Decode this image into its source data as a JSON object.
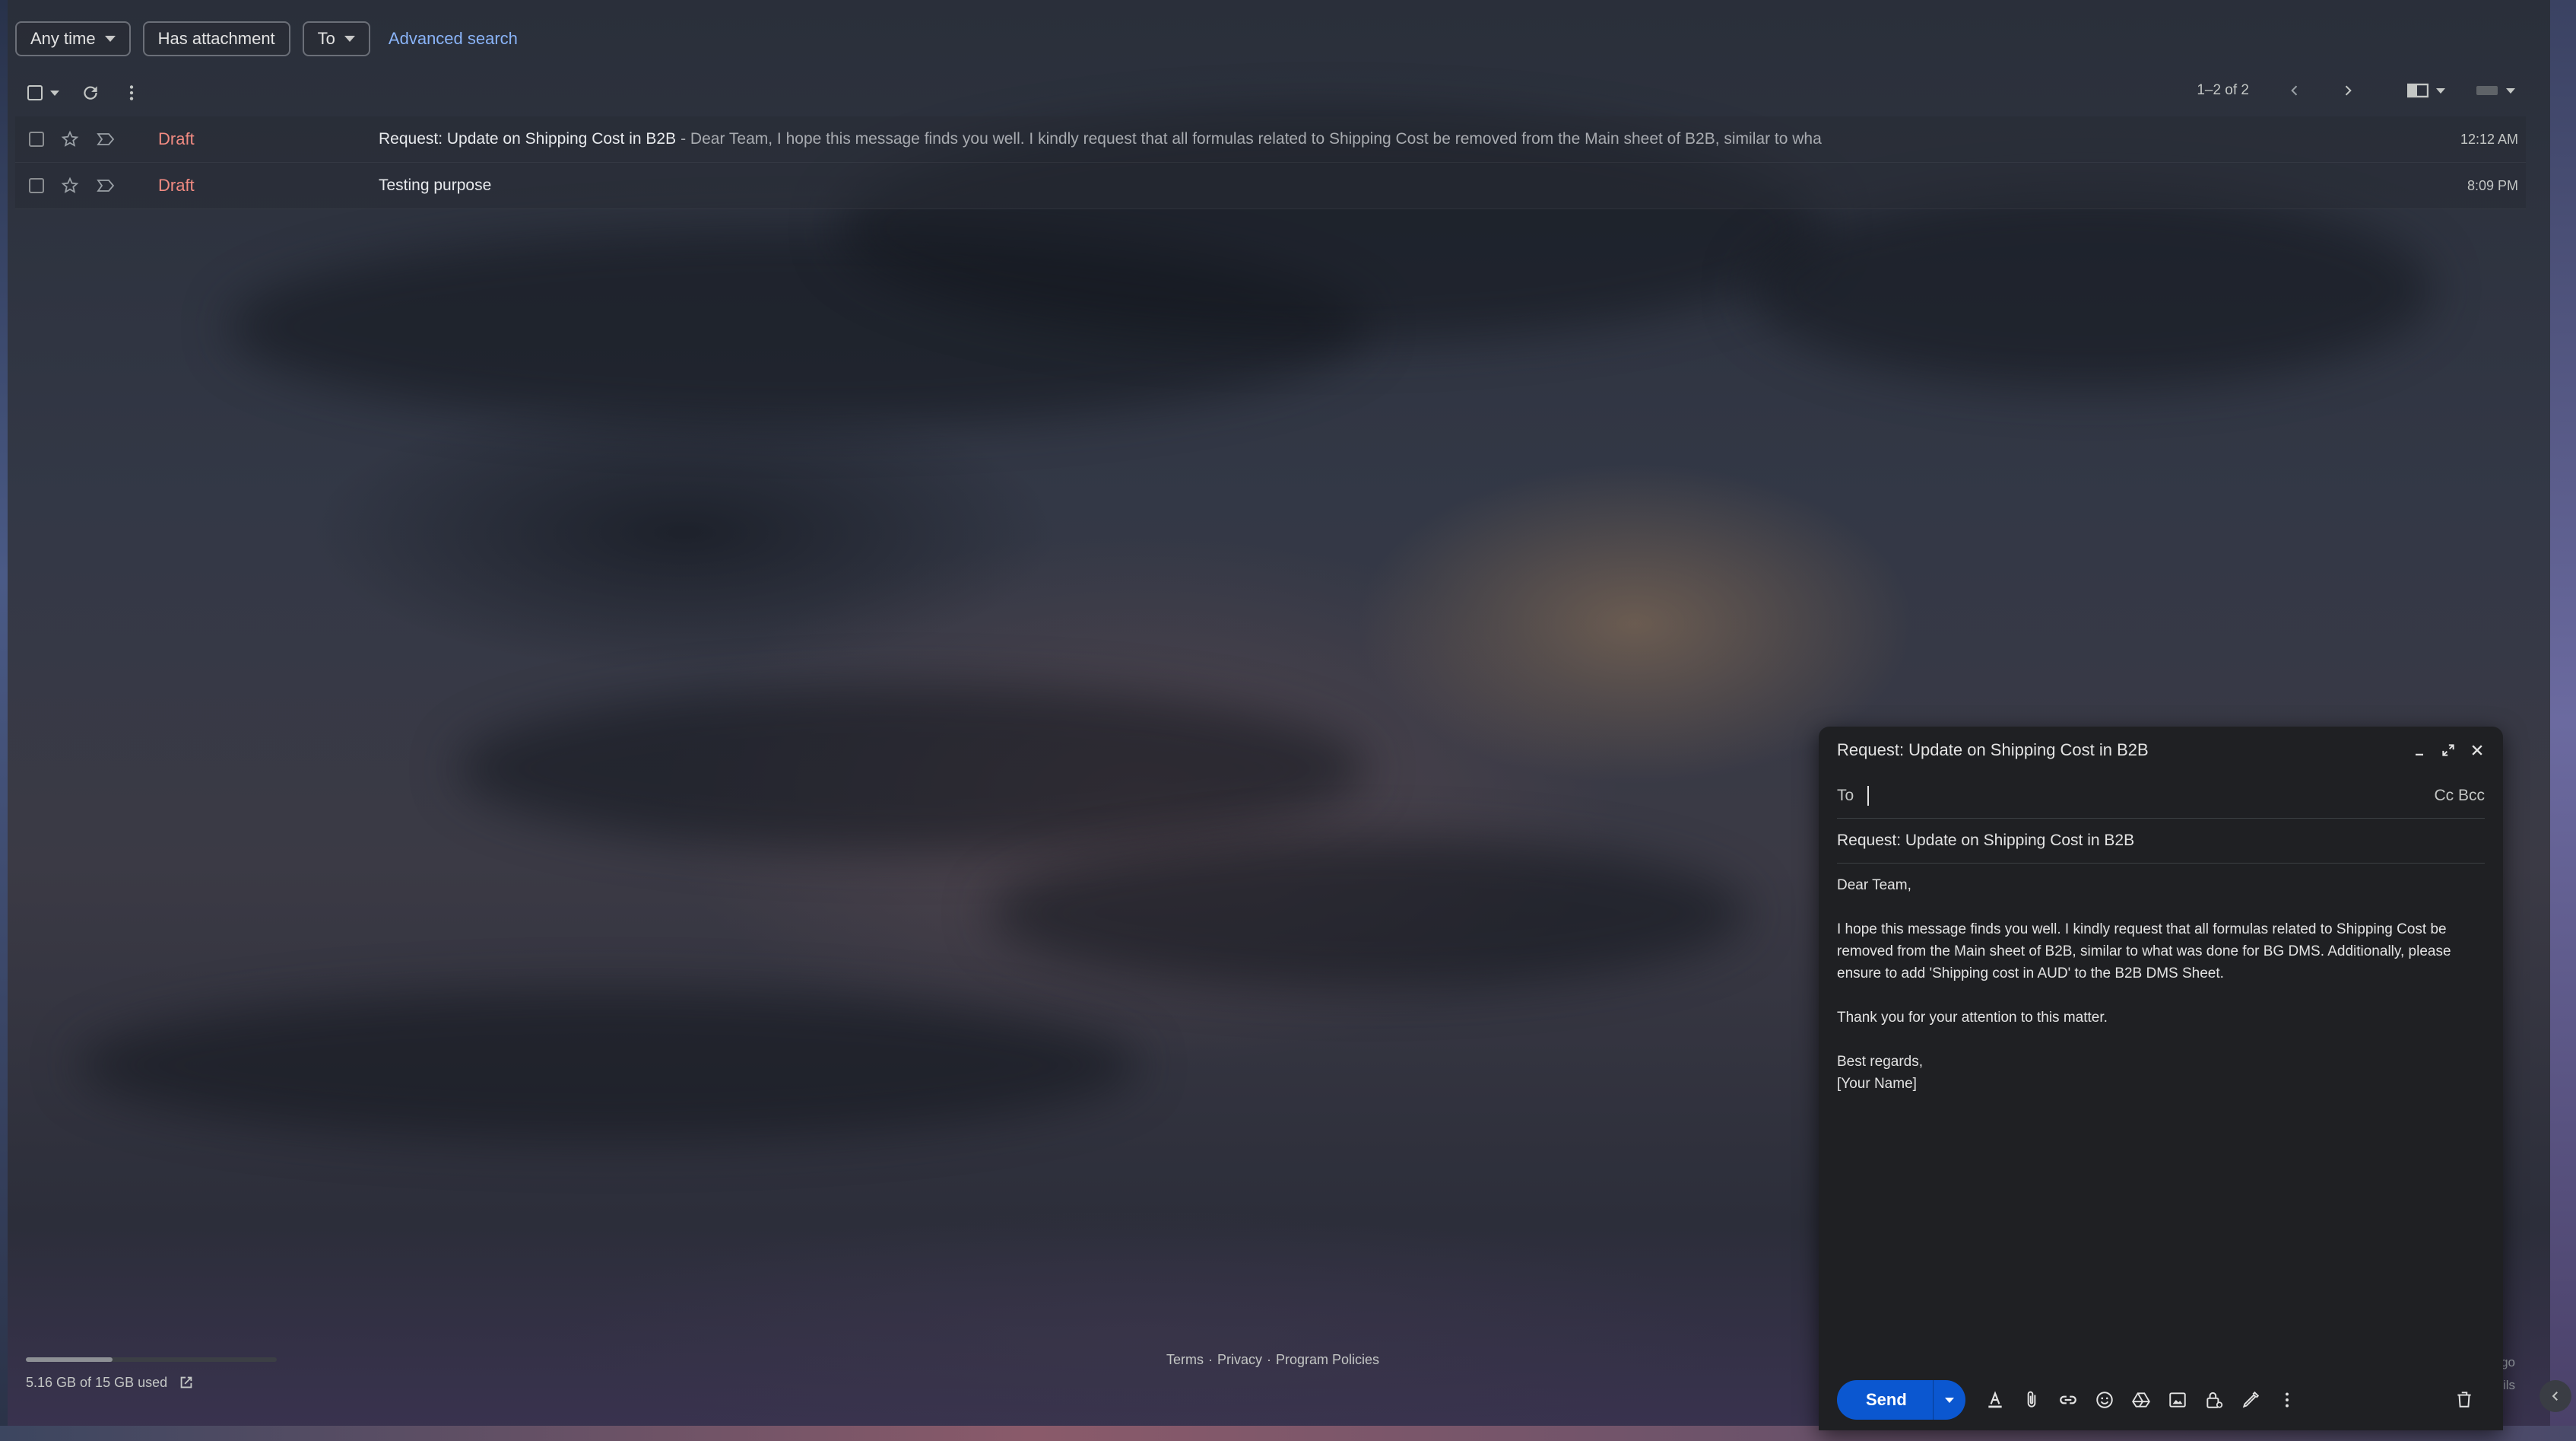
{
  "filters": {
    "any_time": "Any time",
    "has_attachment": "Has attachment",
    "to": "To",
    "advanced_search": "Advanced search"
  },
  "toolbar": {
    "pagination": "1–2 of 2"
  },
  "emails": [
    {
      "label": "Draft",
      "subject": "Request: Update on Shipping Cost in B2B",
      "snippet": "- Dear Team, I hope this message finds you well. I kindly request that all formulas related to Shipping Cost be removed from the Main sheet of B2B, similar to wha",
      "time": "12:12 AM"
    },
    {
      "label": "Draft",
      "subject": "Testing purpose",
      "snippet": "",
      "time": "8:09 PM"
    }
  ],
  "footer": {
    "storage": "5.16 GB of 15 GB used",
    "storage_fraction": 0.344,
    "terms": "Terms",
    "privacy": "Privacy",
    "program_policies": "Program Policies",
    "sep": "·",
    "peek_line1": "go",
    "peek_line2": "ils"
  },
  "compose": {
    "title": "Request: Update on Shipping Cost in B2B",
    "to_label": "To",
    "to_value": "",
    "cc_bcc": "Cc Bcc",
    "subject": "Request: Update on Shipping Cost in B2B",
    "greeting": "Dear Team,",
    "paragraph1": "I hope this message finds you well. I kindly request that all formulas related to Shipping Cost be removed from the Main sheet of B2B, similar to what was done for BG DMS. Additionally, please ensure to add 'Shipping cost in AUD' to the B2B DMS Sheet.",
    "paragraph2": "Thank you for your attention to this matter.",
    "signoff": "Best regards,",
    "name": "[Your Name]",
    "send_label": "Send"
  },
  "colors": {
    "draft_label": "#f28b82",
    "send_button": "#0b57d0",
    "link": "#8ab4f8"
  }
}
